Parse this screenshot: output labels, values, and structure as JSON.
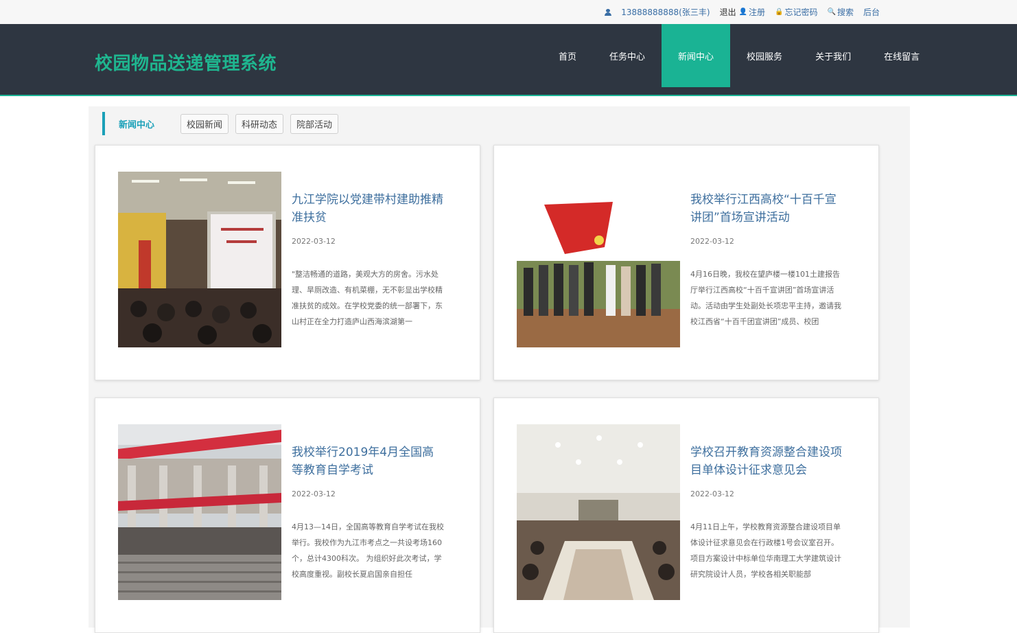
{
  "topbar": {
    "user": "13888888888(张三丰)",
    "logout": "退出",
    "register": "注册",
    "forgot_password": "忘记密码",
    "search": "搜索",
    "admin": "后台"
  },
  "header": {
    "brand": "校园物品送递管理系统",
    "nav": [
      "首页",
      "任务中心",
      "新闻中心",
      "校园服务",
      "关于我们",
      "在线留言"
    ],
    "active_nav": "新闻中心"
  },
  "subnav": {
    "title": "新闻中心",
    "tags": [
      "校园新闻",
      "科研动态",
      "院部活动"
    ]
  },
  "news": [
    {
      "title": "九江学院以党建带村建助推精准扶贫",
      "date": "2022-03-12",
      "summary": "\"整洁畅通的道路，美观大方的房舍。污水处理、旱厕改造、有机菜棚，无不彰显出学校精准扶贫的成效。在学校党委的统一部署下，东山村正在全力打造庐山西海滨湖第一"
    },
    {
      "title": "我校举行江西高校“十百千宣讲团”首场宣讲活动",
      "date": "2022-03-12",
      "summary": "4月16日晚，我校在望庐楼一楼101土建报告厅举行江西高校“十百千宣讲团”首场宣讲活动。活动由学生处副处长项忠平主持，邀请我校江西省“十百千团宣讲团”成员、校团"
    },
    {
      "title": "我校举行2019年4月全国高等教育自学考试",
      "date": "2022-03-12",
      "summary": "4月13—14日，全国高等教育自学考试在我校举行。我校作为九江市考点之一共设考场160个，总计4300科次。 为组织好此次考试，学校高度重视。副校长夏启国亲自担任"
    },
    {
      "title": "学校召开教育资源整合建设项目单体设计征求意见会",
      "date": "2022-03-12",
      "summary": "4月11日上午，学校教育资源整合建设项目单体设计征求意见会在行政楼1号会议室召开。项目方案设计中标单位华南理工大学建筑设计研究院设计人员，学校各相关职能部"
    }
  ],
  "colors": {
    "accent": "#1ab394",
    "header_bg": "#2e3641",
    "brand": "#1fb58f",
    "title_link": "#3e6f9e"
  }
}
